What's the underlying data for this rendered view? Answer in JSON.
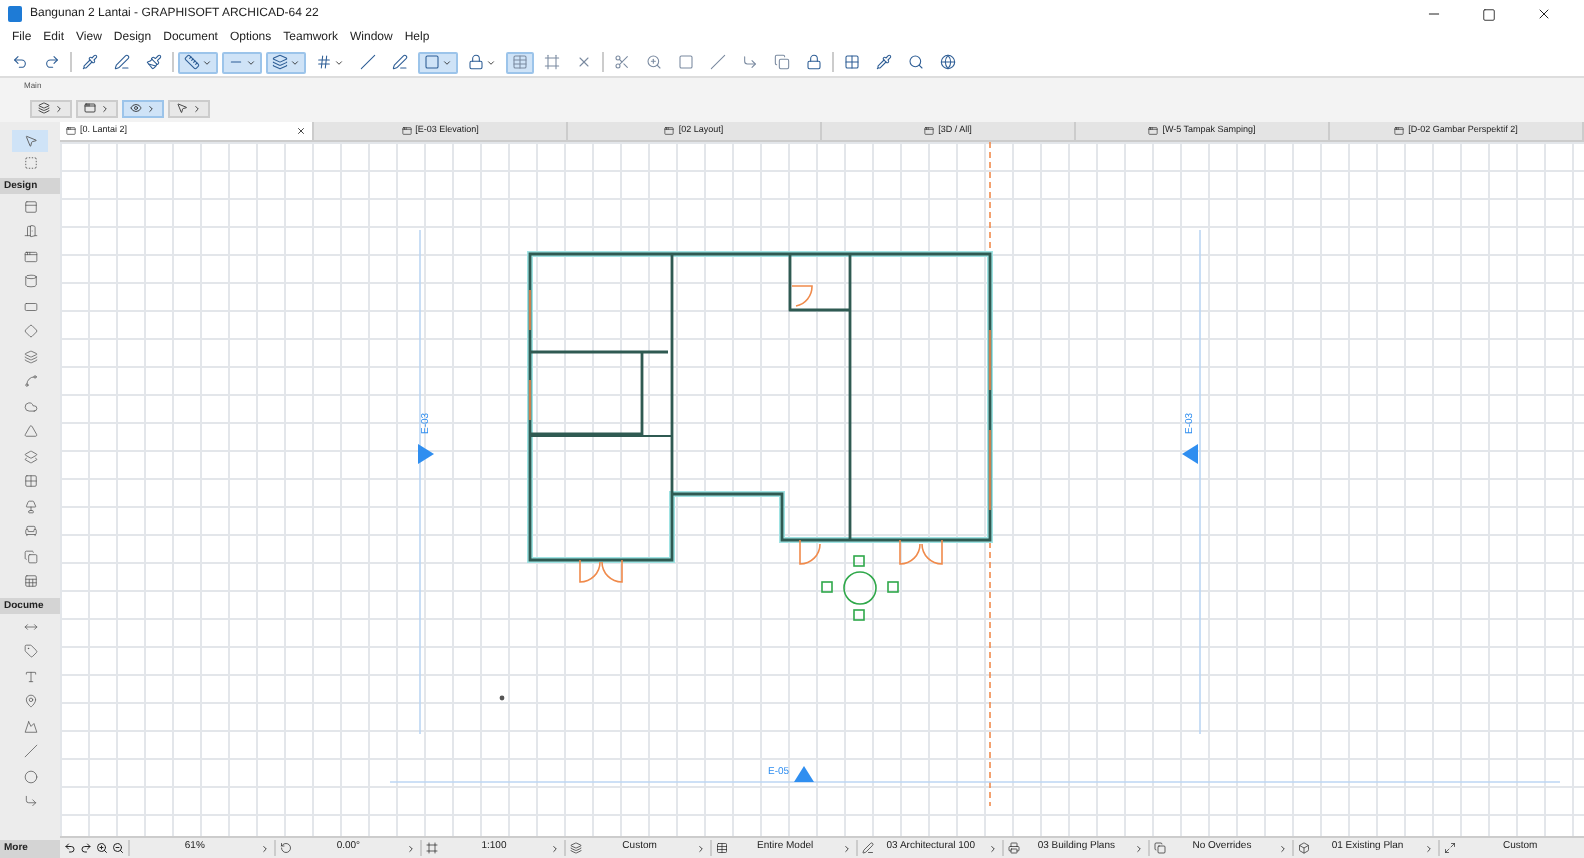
{
  "window": {
    "title": "Bangunan 2 Lantai - GRAPHISOFT ARCHICAD-64 22"
  },
  "menu": [
    "File",
    "Edit",
    "View",
    "Design",
    "Document",
    "Options",
    "Teamwork",
    "Window",
    "Help"
  ],
  "toolbar": [
    {
      "selected": false
    },
    {
      "selected": false
    },
    {
      "selected": false
    },
    {
      "selected": false
    },
    {
      "selected": false
    },
    {
      "selected": true
    },
    {
      "selected": true
    },
    {
      "selected": true
    },
    {
      "selected": false
    },
    {
      "selected": false
    },
    {
      "selected": false
    },
    {
      "selected": true
    },
    {
      "selected": false
    },
    {
      "selected": true
    },
    {
      "selected": false
    },
    {
      "selected": false
    },
    {
      "selected": false
    },
    {
      "selected": false
    },
    {
      "selected": false
    },
    {
      "selected": false
    },
    {
      "selected": false
    },
    {
      "selected": false
    },
    {
      "selected": false
    },
    {
      "selected": false
    },
    {
      "selected": false
    },
    {
      "selected": false
    },
    {
      "selected": false
    }
  ],
  "toolbar_label": "Main",
  "second_toolbar": [
    {
      "selected": false
    },
    {
      "selected": false
    },
    {
      "selected": true
    },
    {
      "selected": false
    }
  ],
  "tabs": [
    {
      "label": "[0. Lantai 2]",
      "selected": true
    },
    {
      "label": "[E-03 Elevation]",
      "selected": false
    },
    {
      "label": "[02 Layout]",
      "selected": false
    },
    {
      "label": "[3D / All]",
      "selected": false
    },
    {
      "label": "[W-5 Tampak Samping]",
      "selected": false
    },
    {
      "label": "[D-02 Gambar Perspektif 2]",
      "selected": false
    }
  ],
  "toolbox": {
    "top": [
      {
        "selected": true
      },
      {
        "selected": false
      }
    ],
    "sections": [
      {
        "title": "Design"
      },
      {
        "title": "Docume"
      }
    ],
    "more": "More"
  },
  "canvas": {
    "markers": [
      {
        "kind": "left",
        "label": "E-03"
      },
      {
        "kind": "right",
        "label": "E-03"
      },
      {
        "kind": "bottom",
        "label": "E-05"
      }
    ]
  },
  "status_bar": [
    {
      "text": "61%"
    },
    {
      "text": "0.00°"
    },
    {
      "text": "1:100"
    },
    {
      "text": "Custom"
    },
    {
      "text": "Entire Model"
    },
    {
      "text": "03 Architectural 100"
    },
    {
      "text": "03 Building Plans"
    },
    {
      "text": "No Overrides"
    },
    {
      "text": "01 Existing Plan"
    },
    {
      "text": "Custom"
    }
  ]
}
